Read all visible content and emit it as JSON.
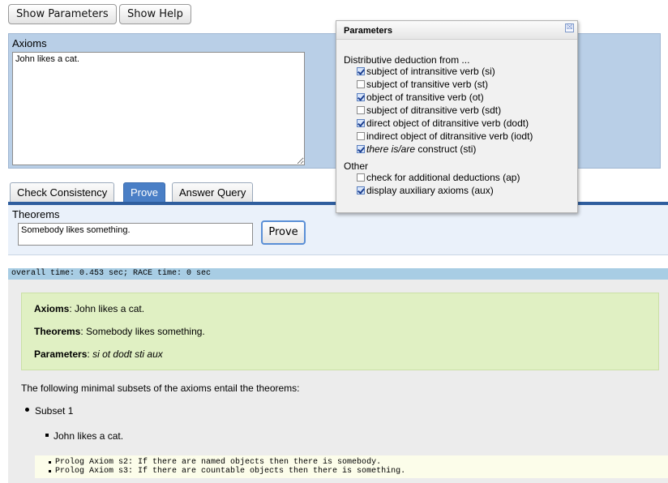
{
  "toolbar": {
    "show_parameters": "Show Parameters",
    "show_help": "Show Help"
  },
  "axioms": {
    "label": "Axioms",
    "value": "John likes a cat."
  },
  "tabs": [
    {
      "label": "Check Consistency",
      "active": false
    },
    {
      "label": "Prove",
      "active": true
    },
    {
      "label": "Answer Query",
      "active": false
    }
  ],
  "theorems": {
    "label": "Theorems",
    "value": "Somebody likes something.",
    "prove_button": "Prove"
  },
  "timing": "overall time: 0.453 sec; RACE time: 0 sec",
  "summary": {
    "axioms_label": "Axioms",
    "axioms_value": ": John likes a cat.",
    "theorems_label": "Theorems",
    "theorems_value": ": Somebody likes something.",
    "parameters_label": "Parameters",
    "parameters_sep": ": ",
    "parameters_value": "si ot dodt sti aux"
  },
  "results": {
    "intro": "The following minimal subsets of the axioms entail the theorems:",
    "subset_label": "Subset 1",
    "subset_item": "John likes a cat.",
    "prolog": [
      "Prolog Axiom s2: If there are named objects then there is somebody.",
      "Prolog Axiom s3: If there are countable objects then there is something."
    ]
  },
  "parameters_popup": {
    "title": "Parameters",
    "close_glyph": "☒",
    "section_distributive": "Distributive deduction from ...",
    "options": [
      {
        "label": "subject of intransitive verb (si)",
        "checked": true
      },
      {
        "label": "subject of transitive verb (st)",
        "checked": false
      },
      {
        "label": "object of transitive verb (ot)",
        "checked": true
      },
      {
        "label": "subject of ditransitive verb (sdt)",
        "checked": false
      },
      {
        "label": "direct object of ditransitive verb (dodt)",
        "checked": true
      },
      {
        "label": "indirect object of ditransitive verb (iodt)",
        "checked": false
      },
      {
        "label_em": "there is/are",
        "label_rest": " construct (sti)",
        "checked": true
      }
    ],
    "section_other": "Other",
    "other_options": [
      {
        "label": "check for additional deductions (ap)",
        "checked": false
      },
      {
        "label": "display auxiliary axioms (aux)",
        "checked": true
      }
    ]
  }
}
